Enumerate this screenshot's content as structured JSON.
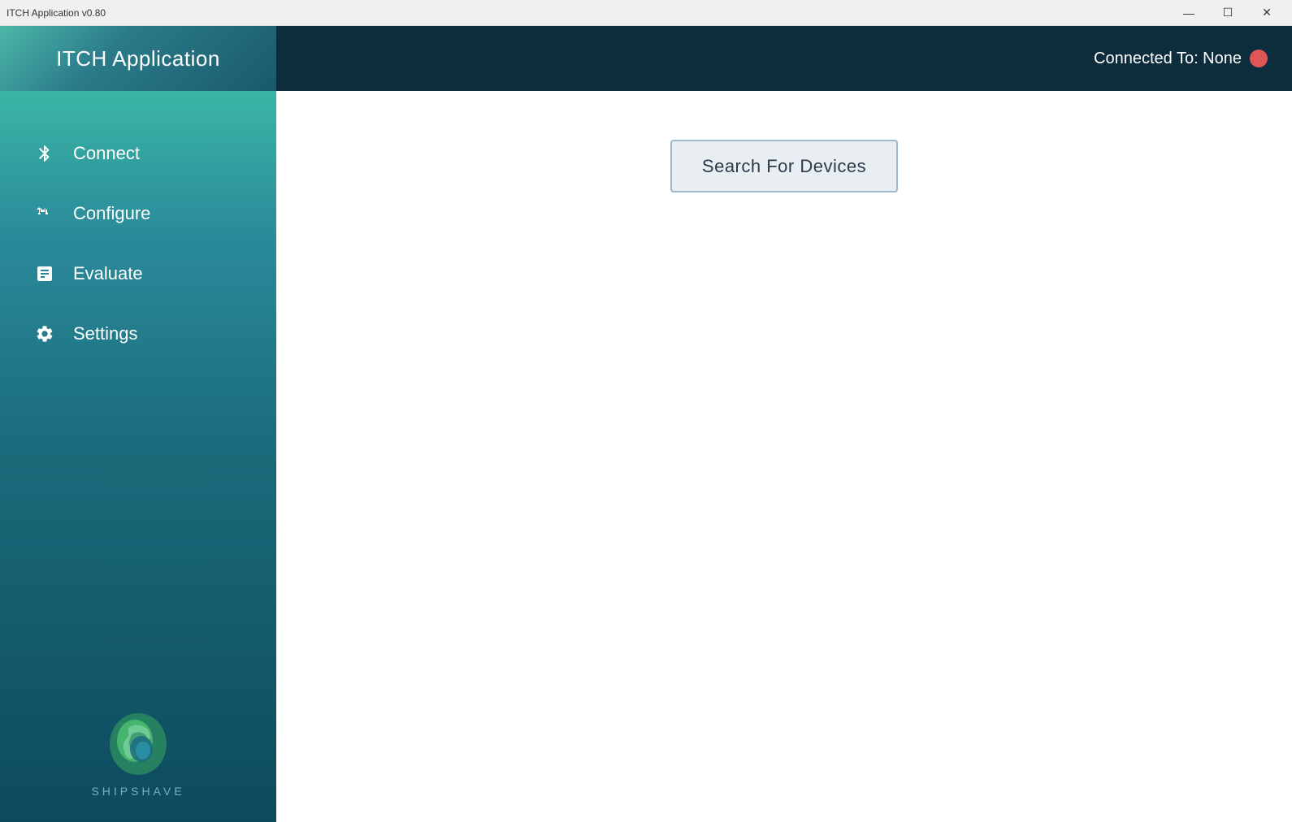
{
  "titlebar": {
    "title": "ITCH Application v0.80",
    "minimize_label": "—",
    "maximize_label": "☐",
    "close_label": "✕"
  },
  "header": {
    "title": "ITCH Application",
    "connection_label": "Connected To: None",
    "connection_status": "disconnected"
  },
  "sidebar": {
    "items": [
      {
        "id": "connect",
        "label": "Connect",
        "icon": "bluetooth"
      },
      {
        "id": "configure",
        "label": "Configure",
        "icon": "usb"
      },
      {
        "id": "evaluate",
        "label": "Evaluate",
        "icon": "chart"
      },
      {
        "id": "settings",
        "label": "Settings",
        "icon": "gear"
      }
    ],
    "logo_text": "SHIPSHAVE"
  },
  "main": {
    "search_button_label": "Search For Devices"
  },
  "colors": {
    "sidebar_gradient_top": "#4db8a8",
    "sidebar_gradient_bottom": "#0d4a5e",
    "header_bg": "#0d2d3d",
    "content_bg": "#ffffff",
    "connection_indicator": "#e05555",
    "search_btn_bg": "#e8eef2",
    "search_btn_border": "#a0b8c8"
  }
}
